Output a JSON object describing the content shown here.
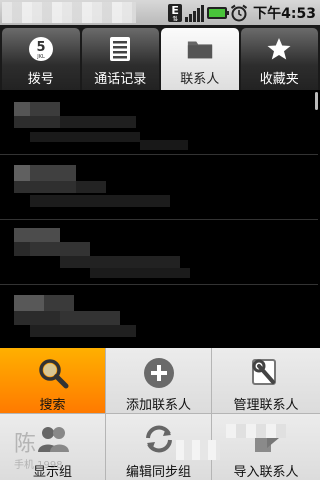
{
  "status_bar": {
    "network": "E",
    "time": "下午4:53",
    "battery_color": "#49c43a"
  },
  "tabs": [
    {
      "label": "拨号",
      "icon": "dialpad-icon",
      "active": false
    },
    {
      "label": "通话记录",
      "icon": "call-log-icon",
      "active": false
    },
    {
      "label": "联系人",
      "icon": "contacts-folder-icon",
      "active": true
    },
    {
      "label": "收藏夹",
      "icon": "star-icon",
      "active": false
    }
  ],
  "dialpad_icon_text": {
    "digit": "5",
    "letters": "JKL"
  },
  "contacts": [
    {
      "name": "",
      "obscured": true
    },
    {
      "name": "",
      "obscured": true
    },
    {
      "name": "",
      "obscured": true
    },
    {
      "name": "",
      "obscured": true
    }
  ],
  "menu": {
    "items": [
      {
        "label": "搜索",
        "icon": "search-icon",
        "selected": true
      },
      {
        "label": "添加联系人",
        "icon": "add-icon",
        "selected": false
      },
      {
        "label": "管理联系人",
        "icon": "manage-icon",
        "selected": false
      },
      {
        "label": "显示组",
        "icon": "group-icon",
        "selected": false
      },
      {
        "label": "编辑同步组",
        "icon": "sync-icon",
        "selected": false
      },
      {
        "label": "导入联系人",
        "icon": "import-icon",
        "selected": false
      }
    ]
  },
  "background_ghost": {
    "name_char": "陈",
    "phone_fragment": "手机 1998"
  },
  "colors": {
    "menu_selected": "#ff8a00",
    "tab_active": "#eeeeee",
    "list_background": "#000000"
  }
}
